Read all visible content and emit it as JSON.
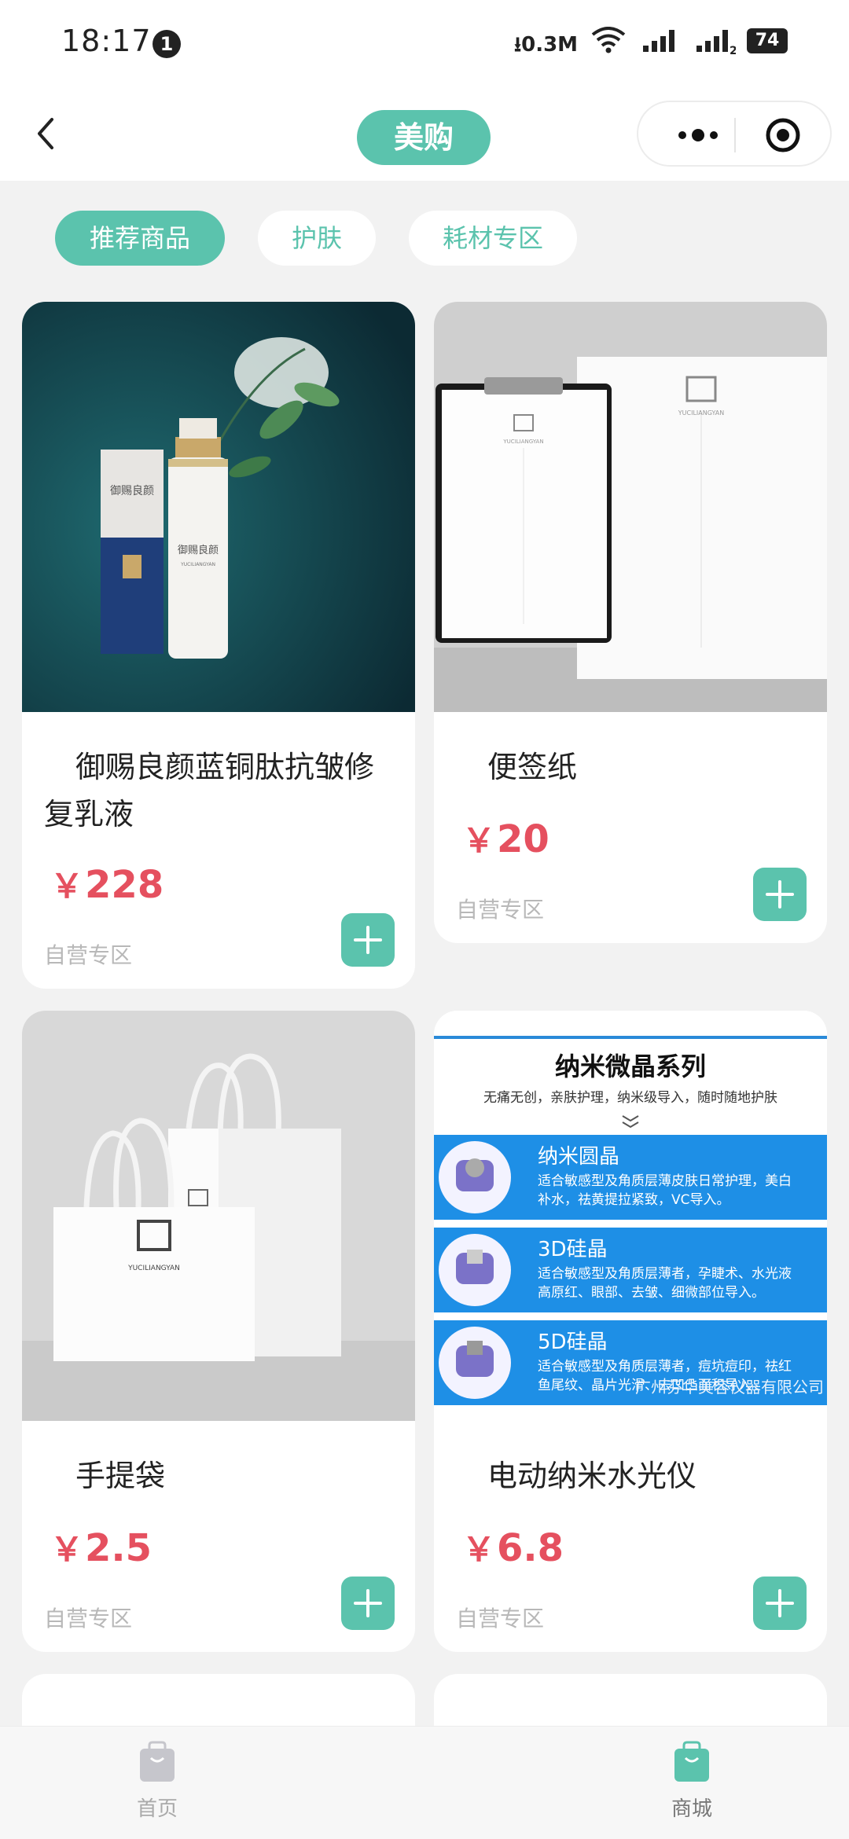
{
  "status_bar": {
    "time": "18:17",
    "notification_count": "1",
    "net_speed": "0.3M",
    "battery": "74",
    "sim2_label": "2"
  },
  "nav": {
    "title": "美购"
  },
  "tabs": [
    {
      "label": "推荐商品",
      "active": true
    },
    {
      "label": "护肤",
      "active": false
    },
    {
      "label": "耗材专区",
      "active": false
    }
  ],
  "products": [
    {
      "name": "御赐良颜蓝铜肽抗皱修复乳液",
      "price_symbol": "￥",
      "price": "228",
      "tag": "自营专区"
    },
    {
      "name": "便签纸",
      "price_symbol": "￥",
      "price": "20",
      "tag": "自营专区"
    },
    {
      "name": "手提袋",
      "price_symbol": "￥",
      "price": "2.5",
      "tag": "自营专区"
    },
    {
      "name": "电动纳米水光仪",
      "price_symbol": "￥",
      "price": "6.8",
      "tag": "自营专区"
    }
  ],
  "product_images": {
    "lotion": {
      "brand": "御赐良颜",
      "sub": "YUCILIANGYAN"
    },
    "notepad": {
      "brand": "YUCILIANGYAN"
    },
    "bag": {
      "brand": "YUCILIANGYAN"
    },
    "nano": {
      "title": "纳米微晶系列",
      "subtitle": "无痛无创，亲肤护理，纳米级导入，随时随地护肤",
      "rows": [
        {
          "name": "纳米圆晶",
          "desc1": "适合敏感型及角质层薄皮肤日常护理，美白",
          "desc2": "补水，祛黄提拉紧致，VC导入。"
        },
        {
          "name": "3D硅晶",
          "desc1": "适合敏感型及角质层薄者，孕睫术、水光液",
          "desc2": "高原红、眼部、去皱、细微部位导入。"
        },
        {
          "name": "5D硅晶",
          "desc1": "适合敏感型及角质层薄者，痘坑痘印，祛红",
          "desc2": "鱼尾纹、晶片光滑、去凹凸面积导入。"
        }
      ],
      "watermark": "广州芬华美容仪器有限公司"
    }
  },
  "tabbar": [
    {
      "label": "首页",
      "active": false
    },
    {
      "label": "商城",
      "active": true
    }
  ],
  "colors": {
    "accent": "#5bc3ad",
    "price": "#e5505f",
    "tag": "#b8b8b8"
  }
}
